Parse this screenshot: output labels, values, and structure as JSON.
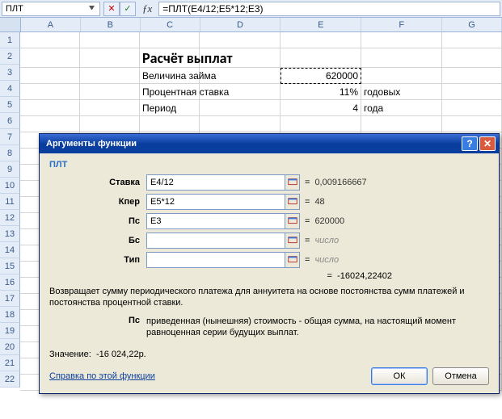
{
  "formula_bar": {
    "namebox": "ПЛТ",
    "formula": "=ПЛТ(E4/12;E5*12;E3)"
  },
  "columns": [
    "A",
    "B",
    "C",
    "D",
    "E",
    "F",
    "G"
  ],
  "rows": [
    "1",
    "2",
    "3",
    "4",
    "5",
    "6",
    "7",
    "8",
    "9",
    "10",
    "11",
    "12",
    "13",
    "14",
    "15",
    "16",
    "17",
    "18",
    "19",
    "20",
    "21",
    "22"
  ],
  "sheet": {
    "c2_title": "Расчёт выплат",
    "c3_label": "Величина займа",
    "e3_value": "620000",
    "c4_label": "Процентная ставка",
    "e4_value": "11%",
    "f4_value": "годовых",
    "c5_label": "Период",
    "e5_value": "4",
    "f5_value": "года"
  },
  "dialog": {
    "title": "Аргументы функции",
    "fn_name": "ПЛТ",
    "args": [
      {
        "label": "Ставка",
        "value": "E4/12",
        "result": "0,009166667",
        "gray": false
      },
      {
        "label": "Кпер",
        "value": "E5*12",
        "result": "48",
        "gray": false
      },
      {
        "label": "Пс",
        "value": "E3",
        "result": "620000",
        "gray": false
      },
      {
        "label": "Бс",
        "value": "",
        "result": "число",
        "gray": true
      },
      {
        "label": "Тип",
        "value": "",
        "result": "число",
        "gray": true
      }
    ],
    "formula_result": "-16024,22402",
    "description": "Возвращает сумму периодического платежа для аннуитета на основе постоянства сумм платежей и постоянства процентной ставки.",
    "param_label": "Пс",
    "param_desc": "приведенная (нынешняя) стоимость - общая сумма, на настоящий момент равноценная серии будущих выплат.",
    "value_label": "Значение:",
    "value": "-16 024,22р.",
    "help_link": "Справка по этой функции",
    "btn_ok": "ОК",
    "btn_cancel": "Отмена"
  }
}
